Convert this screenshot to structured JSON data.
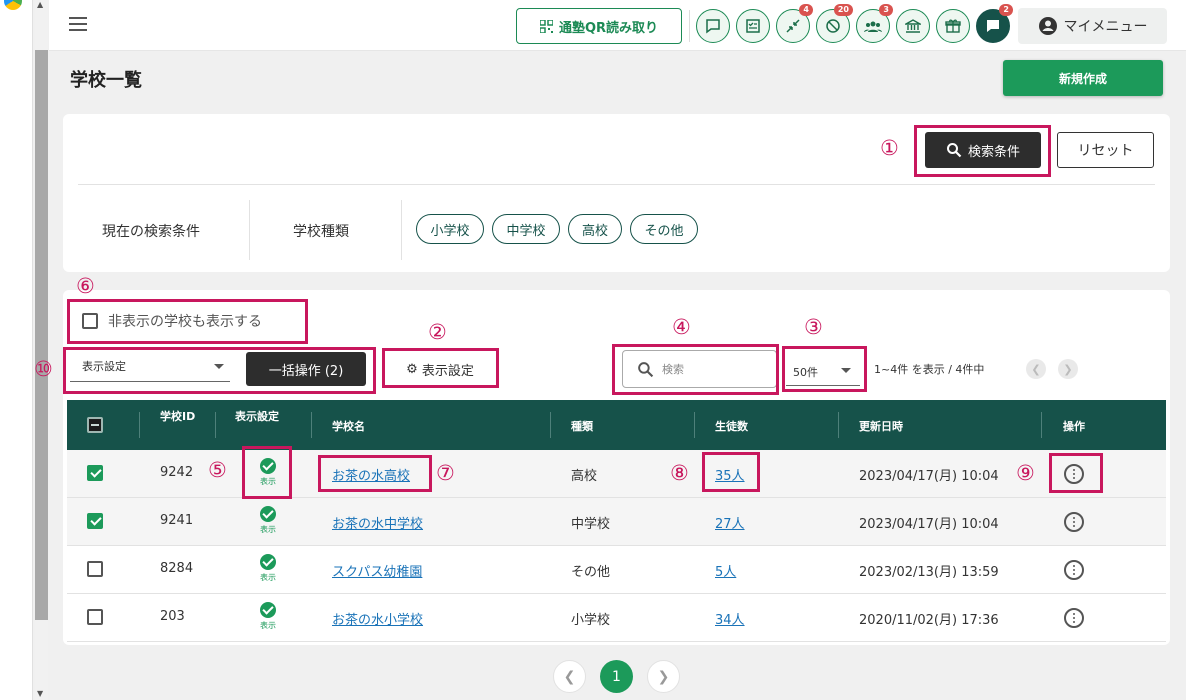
{
  "header": {
    "qr_button": "通塾QR読み取り",
    "icons": [
      {
        "name": "chat-icon",
        "badge": ""
      },
      {
        "name": "checklist-icon",
        "badge": ""
      },
      {
        "name": "arrows-icon",
        "badge": "4"
      },
      {
        "name": "ban-icon",
        "badge": "20"
      },
      {
        "name": "group-icon",
        "badge": "3"
      },
      {
        "name": "bank-icon",
        "badge": ""
      },
      {
        "name": "gift-icon",
        "badge": ""
      },
      {
        "name": "message-icon",
        "badge": "2"
      }
    ],
    "my_menu": "マイメニュー"
  },
  "page": {
    "title": "学校一覧",
    "new_button": "新規作成"
  },
  "search": {
    "search_button": "検索条件",
    "reset_button": "リセット",
    "current_label": "現在の検索条件",
    "type_label": "学校種類",
    "chips": [
      "小学校",
      "中学校",
      "高校",
      "その他"
    ]
  },
  "list": {
    "show_hidden_label": "非表示の学校も表示する",
    "display_select": "表示設定",
    "bulk_button": "一括操作 (2)",
    "display_settings_button": "表示設定",
    "search_placeholder": "検索",
    "per_page": "50件",
    "page_info": "1~4件 を表示 / 4件中"
  },
  "table": {
    "headers": [
      "学校ID",
      "表示設定",
      "学校名",
      "種類",
      "生徒数",
      "更新日時",
      "操作"
    ],
    "rows": [
      {
        "checked": true,
        "id": "9242",
        "display": "表示",
        "name": "お茶の水高校",
        "type": "高校",
        "students": "35人",
        "updated": "2023/04/17(月) 10:04"
      },
      {
        "checked": true,
        "id": "9241",
        "display": "表示",
        "name": "お茶の水中学校",
        "type": "中学校",
        "students": "27人",
        "updated": "2023/04/17(月) 10:04"
      },
      {
        "checked": false,
        "id": "8284",
        "display": "表示",
        "name": "スクパス幼稚園",
        "type": "その他",
        "students": "5人",
        "updated": "2023/02/13(月) 13:59"
      },
      {
        "checked": false,
        "id": "203",
        "display": "表示",
        "name": "お茶の水小学校",
        "type": "小学校",
        "students": "34人",
        "updated": "2020/11/02(月) 17:36"
      }
    ]
  },
  "pagination": {
    "current": "1"
  },
  "annotations": [
    "①",
    "②",
    "③",
    "④",
    "⑤",
    "⑥",
    "⑦",
    "⑧",
    "⑨",
    "⑩"
  ],
  "colors": {
    "primary": "#1c9a5a",
    "header_bg": "#16524a",
    "highlight": "#c8175d",
    "link": "#1a73b8"
  }
}
